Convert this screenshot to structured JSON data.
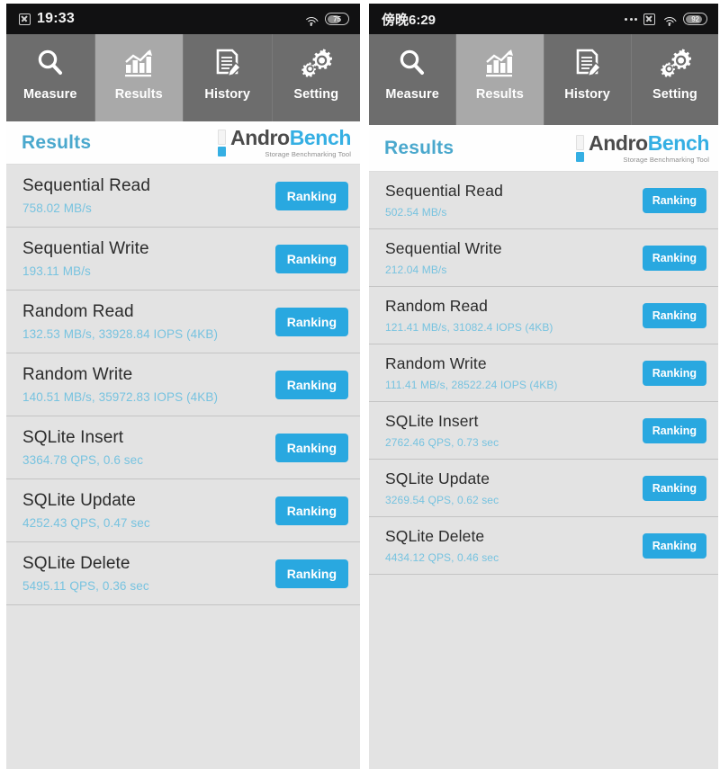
{
  "panels": [
    {
      "id": "left",
      "statusbar": {
        "time": "19:33",
        "boxx_icon": "boxed-x-icon",
        "wifi_icon": "wifi-icon",
        "battery_level": "75"
      },
      "tabs": [
        {
          "label": "Measure",
          "icon": "magnifier-icon",
          "active": false
        },
        {
          "label": "Results",
          "icon": "bar-chart-icon",
          "active": true
        },
        {
          "label": "History",
          "icon": "document-pencil-icon",
          "active": false
        },
        {
          "label": "Setting",
          "icon": "gears-icon",
          "active": false
        }
      ],
      "header": {
        "title": "Results",
        "logo_name_a": "Andro",
        "logo_name_b": "Bench",
        "logo_tagline": "Storage Benchmarking Tool"
      },
      "rank_label": "Ranking",
      "rows": [
        {
          "title": "Sequential Read",
          "value": "758.02 MB/s"
        },
        {
          "title": "Sequential Write",
          "value": "193.11 MB/s"
        },
        {
          "title": "Random Read",
          "value": "132.53 MB/s, 33928.84 IOPS (4KB)"
        },
        {
          "title": "Random Write",
          "value": "140.51 MB/s, 35972.83 IOPS (4KB)"
        },
        {
          "title": "SQLite Insert",
          "value": "3364.78 QPS, 0.6 sec"
        },
        {
          "title": "SQLite Update",
          "value": "4252.43 QPS, 0.47 sec"
        },
        {
          "title": "SQLite Delete",
          "value": "5495.11 QPS, 0.36 sec"
        }
      ]
    },
    {
      "id": "right",
      "statusbar": {
        "time": "傍晚6:29",
        "dots_icon": "more-dots-icon",
        "boxx_icon": "boxed-x-icon",
        "wifi_icon": "wifi-icon",
        "battery_level": "92"
      },
      "tabs": [
        {
          "label": "Measure",
          "icon": "magnifier-icon",
          "active": false
        },
        {
          "label": "Results",
          "icon": "bar-chart-icon",
          "active": true
        },
        {
          "label": "History",
          "icon": "document-pencil-icon",
          "active": false
        },
        {
          "label": "Setting",
          "icon": "gears-icon",
          "active": false
        }
      ],
      "header": {
        "title": "Results",
        "logo_name_a": "Andro",
        "logo_name_b": "Bench",
        "logo_tagline": "Storage Benchmarking Tool"
      },
      "rank_label": "Ranking",
      "rows": [
        {
          "title": "Sequential Read",
          "value": "502.54 MB/s"
        },
        {
          "title": "Sequential Write",
          "value": "212.04 MB/s"
        },
        {
          "title": "Random Read",
          "value": "121.41 MB/s, 31082.4 IOPS (4KB)"
        },
        {
          "title": "Random Write",
          "value": "111.41 MB/s, 28522.24 IOPS (4KB)"
        },
        {
          "title": "SQLite Insert",
          "value": "2762.46 QPS, 0.73 sec"
        },
        {
          "title": "SQLite Update",
          "value": "3269.54 QPS, 0.62 sec"
        },
        {
          "title": "SQLite Delete",
          "value": "4434.12 QPS, 0.46 sec"
        }
      ]
    }
  ],
  "colors": {
    "accent_blue": "#29a8e0",
    "value_blue": "#77c3e0",
    "title_blue": "#4aa8cd",
    "tab_inactive": "#6d6d6d",
    "tab_active": "#a9a9a9",
    "list_bg": "#e3e3e3",
    "statusbar_bg": "#111112"
  }
}
